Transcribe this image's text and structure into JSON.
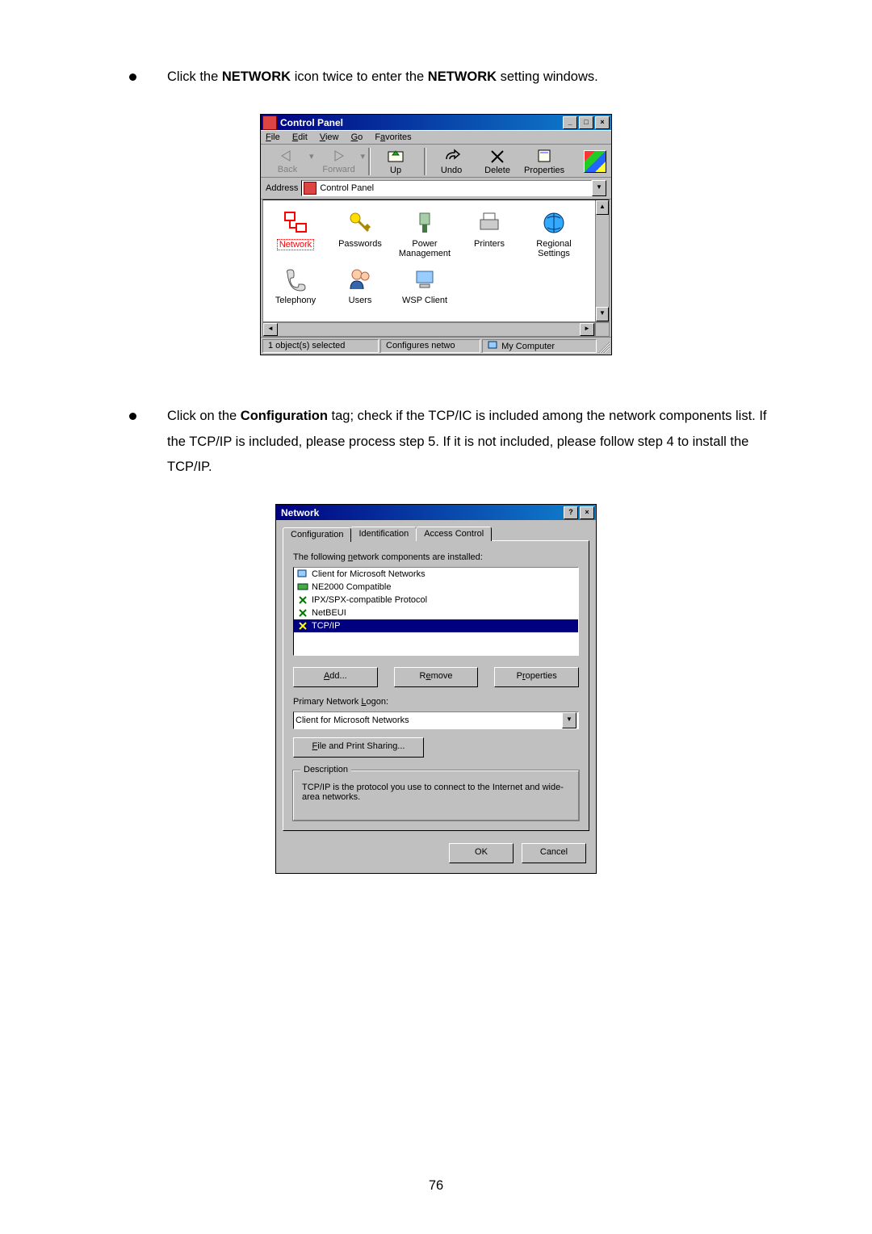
{
  "bullets": {
    "b1_pre": "Click the ",
    "b1_bold1": "NETWORK",
    "b1_mid": " icon twice to enter the ",
    "b1_bold2": "NETWORK",
    "b1_post": " setting windows.",
    "b2_pre": "Click on the ",
    "b2_bold": "Configuration",
    "b2_rest": " tag; check if the TCP/IC is included among the network components list. If the TCP/IP is included, please process step 5. If it is not included, please follow step 4 to install the TCP/IP."
  },
  "page_number": "76",
  "cp": {
    "title": "Control Panel",
    "menus": {
      "file": "File",
      "edit": "Edit",
      "view": "View",
      "go": "Go",
      "fav": "Favorites"
    },
    "tools": {
      "back": "Back",
      "forward": "Forward",
      "up": "Up",
      "undo": "Undo",
      "delete": "Delete",
      "props": "Properties"
    },
    "address_label": "Address",
    "address_value": "Control Panel",
    "items": {
      "network": "Network",
      "passwords": "Passwords",
      "power": "Power\nManagement",
      "printers": "Printers",
      "regional": "Regional\nSettings",
      "telephony": "Telephony",
      "users": "Users",
      "wsp": "WSP Client"
    },
    "status": {
      "left": "1 object(s) selected",
      "mid": "Configures netwo",
      "right": "My Computer"
    }
  },
  "nw": {
    "title": "Network",
    "tabs": {
      "config": "Configuration",
      "ident": "Identification",
      "access": "Access Control"
    },
    "list_label": "The following network components are installed:",
    "components": {
      "c1": "Client for Microsoft Networks",
      "c2": "NE2000 Compatible",
      "c3": "IPX/SPX-compatible Protocol",
      "c4": "NetBEUI",
      "c5": "TCP/IP"
    },
    "btn_add": "Add...",
    "btn_remove": "Remove",
    "btn_props": "Properties",
    "logon_label": "Primary Network Logon:",
    "logon_value": "Client for Microsoft Networks",
    "btn_share": "File and Print Sharing...",
    "desc_legend": "Description",
    "desc_text": "TCP/IP is the protocol you use to connect to the Internet and wide-area networks.",
    "btn_ok": "OK",
    "btn_cancel": "Cancel"
  }
}
